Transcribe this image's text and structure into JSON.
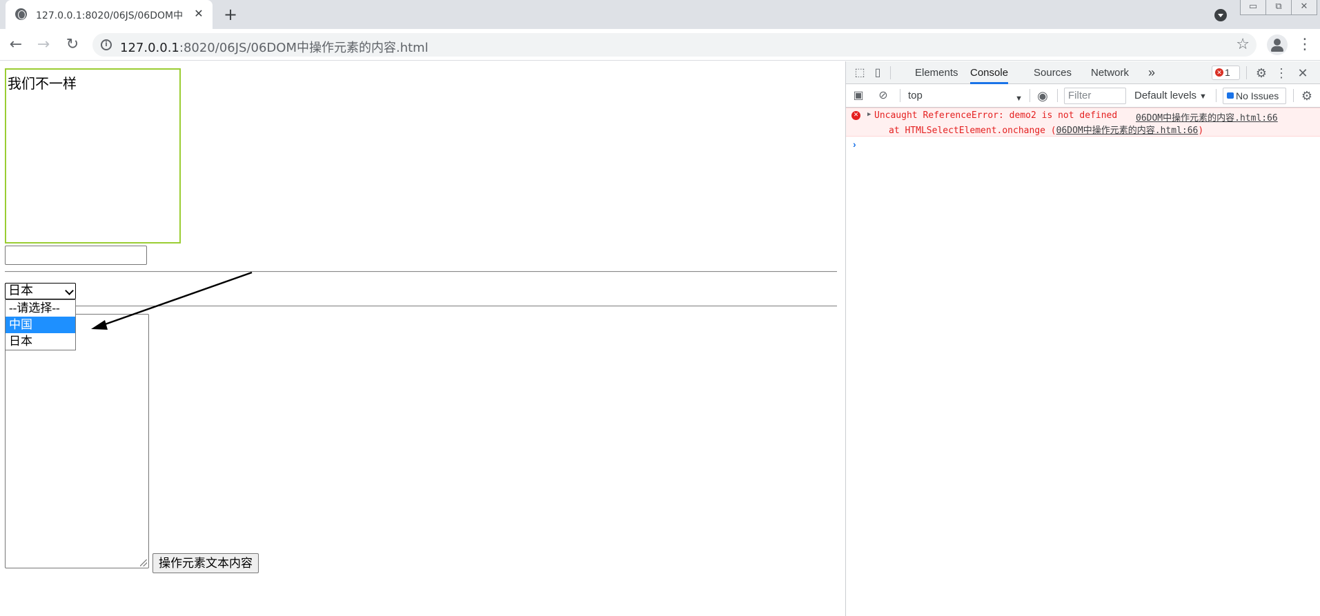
{
  "browser": {
    "tab_title": "127.0.0.1:8020/06JS/06DOM中",
    "tab_close": "✕",
    "new_tab": "+",
    "url_host": "127.0.0.1",
    "url_path": ":8020/06JS/06DOM中操作元素的内容.html",
    "back": "←",
    "forward": "→",
    "reload": "↻",
    "star": "☆",
    "menu": "⋮",
    "win_minimize": "▭",
    "win_restore": "⧉",
    "win_close": "✕"
  },
  "page": {
    "div_text": "我们不一样",
    "select_value": "日本",
    "dropdown_options": [
      "--请选择--",
      "中国",
      "日本"
    ],
    "dropdown_selected_index": 1,
    "button_label": "操作元素文本内容"
  },
  "devtools": {
    "tabs": [
      "Elements",
      "Console",
      "Sources",
      "Network"
    ],
    "active_tab": "Console",
    "more_tabs": "»",
    "error_count": "1",
    "context": "top",
    "filter_placeholder": "Filter",
    "levels": "Default levels",
    "no_issues": "No Issues",
    "error_line1": "Uncaught ReferenceError: demo2 is not defined",
    "error_source": "06DOM中操作元素的内容.html:66",
    "error_line2_prefix": "at HTMLSelectElement.onchange (",
    "error_line2_link": "06DOM中操作元素的内容.html:66",
    "error_line2_suffix": ")",
    "prompt": "›"
  },
  "colors": {
    "div_border": "#9acd32",
    "selected_option": "#1e90ff",
    "error_text": "#e41f1f",
    "error_bg": "#fff0f0",
    "active_tab_underline": "#1a73e8"
  },
  "icons": [
    "globe-icon",
    "back-arrow-icon",
    "forward-arrow-icon",
    "reload-icon",
    "info-icon",
    "star-icon",
    "profile-icon",
    "menu-icon",
    "inspect-icon",
    "device-toggle-icon",
    "settings-icon",
    "kebab-icon",
    "close-icon",
    "sidebar-icon",
    "clear-console-icon",
    "eye-icon",
    "error-icon"
  ]
}
